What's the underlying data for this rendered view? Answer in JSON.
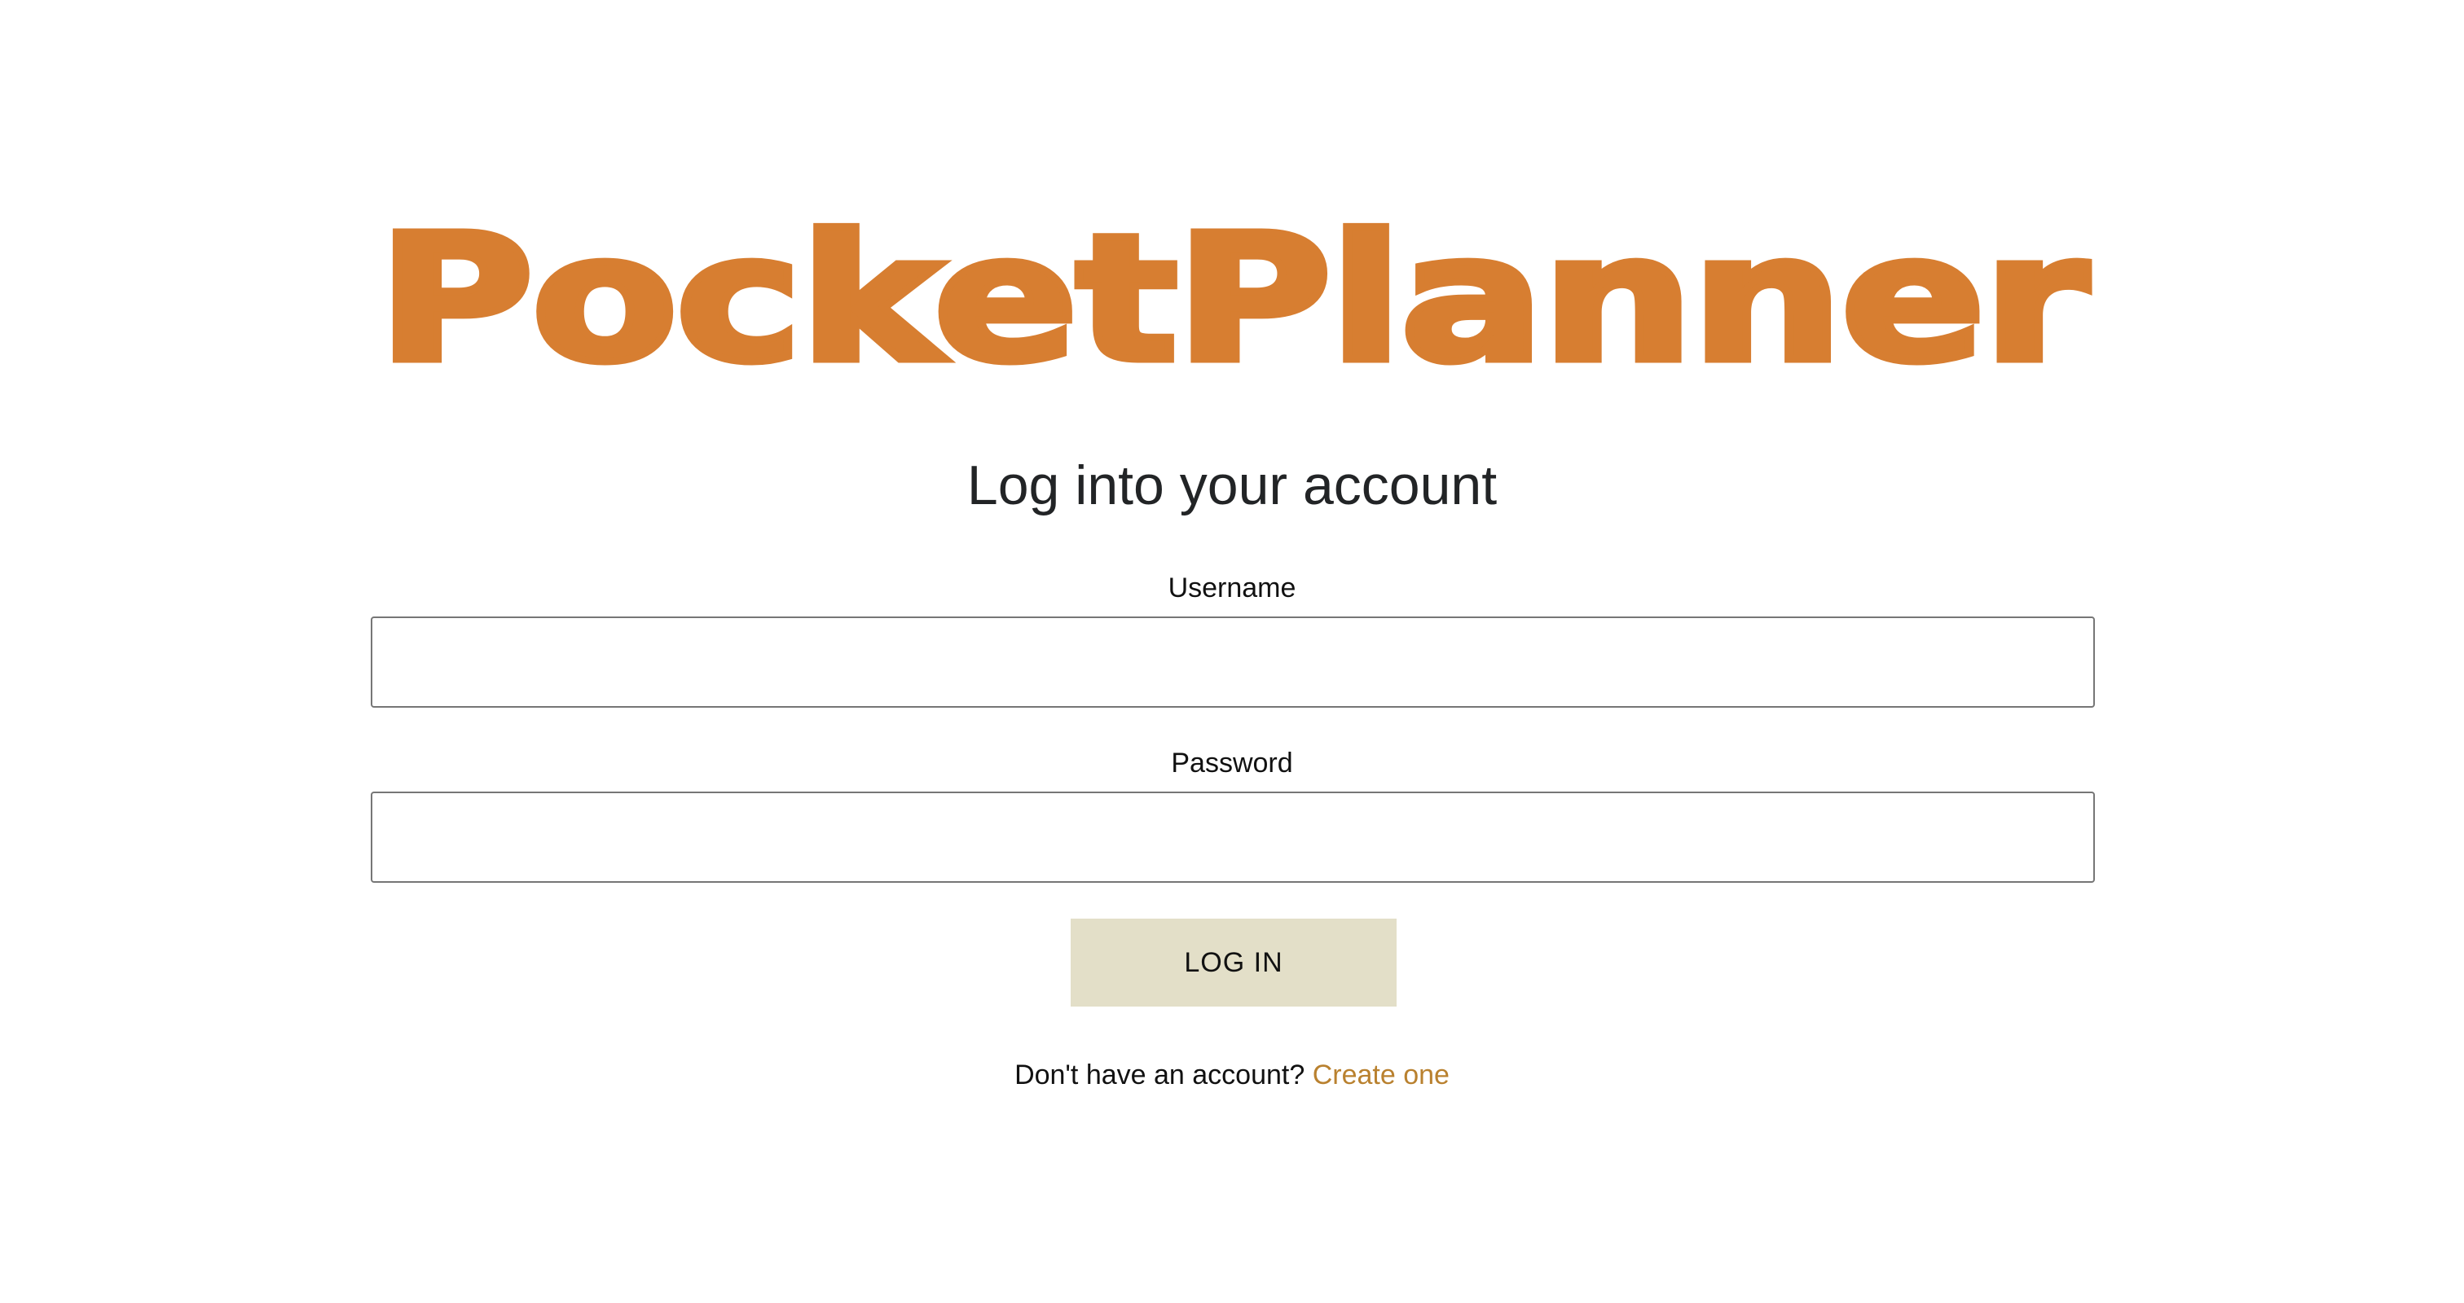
{
  "app": {
    "logo_text": "PocketPlanner"
  },
  "login": {
    "heading": "Log into your account",
    "username": {
      "label": "Username",
      "value": "",
      "placeholder": ""
    },
    "password": {
      "label": "Password",
      "value": "",
      "placeholder": ""
    },
    "submit_label": "LOG IN",
    "signup_prompt": "Don't have an account?",
    "signup_link": "Create one"
  },
  "colors": {
    "brand": "#d77e31",
    "button_bg": "#e3dfc8",
    "link": "#b9812f"
  }
}
